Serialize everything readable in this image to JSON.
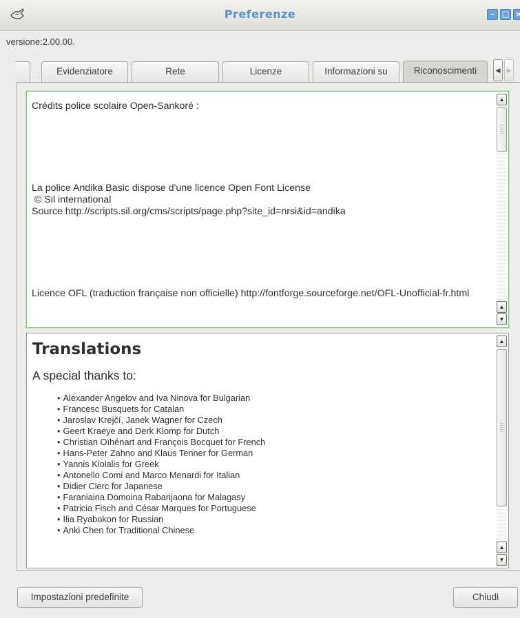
{
  "window": {
    "title": "Preferenze",
    "minimize_glyph": "–",
    "maximize_glyph": "□",
    "close_glyph": "×"
  },
  "version_label": "versione:2.00.00.",
  "tabs": [
    {
      "label": "Evidenziatore",
      "active": false
    },
    {
      "label": "Rete",
      "active": false
    },
    {
      "label": "Licenze",
      "active": false
    },
    {
      "label": "Informazioni su",
      "active": false
    },
    {
      "label": "Riconoscimenti",
      "active": true
    }
  ],
  "tab_scroll": {
    "left_glyph": "◀",
    "right_glyph": "▶"
  },
  "credits": {
    "heading": "Crédits police scolaire Open-Sankoré :",
    "license_line": "La police Andika Basic dispose d'une licence Open Font License",
    "copyright_line": " © Sil international",
    "source_line": "Source http://scripts.sil.org/cms/scripts/page.php?site_id=nrsi&id=andika",
    "ofl_line": "Licence OFL (traduction française non officielle) http://fontforge.sourceforge.net/OFL-Unofficial-fr.html"
  },
  "translations": {
    "title": "Translations",
    "intro": "A special thanks to:",
    "items": [
      "Alexander Angelov and Iva Ninova for Bulgarian",
      "Francesc Busquets for Catalan",
      "Jaroslav Krejčí, Janek Wagner for Czech",
      "Geert Kraeye and Derk Klomp for Dutch",
      "Christian Oïhénart and François Bocquet for French",
      "Hans-Peter Zahno and Klaus Tenner for German",
      "Yannis Kiolalis for Greek",
      "Antonello Comi and Marco Menardi for Italian",
      "Didier Clerc for Japanese",
      "Faraniaina Domoina Rabarijaona for Malagasy",
      "Patricia Fisch and César Marques for Portuguese",
      "Ilia Ryabokon for Russian",
      "Anki Chen for Traditional Chinese"
    ]
  },
  "scroll_glyphs": {
    "up": "▲",
    "down": "▼"
  },
  "buttons": {
    "defaults": "Impostazioni predefinite",
    "close": "Chiudi"
  },
  "colors": {
    "title_text": "#5b8fc6",
    "window_buttons": "#6da2d6",
    "focus_border": "#76c97a"
  }
}
